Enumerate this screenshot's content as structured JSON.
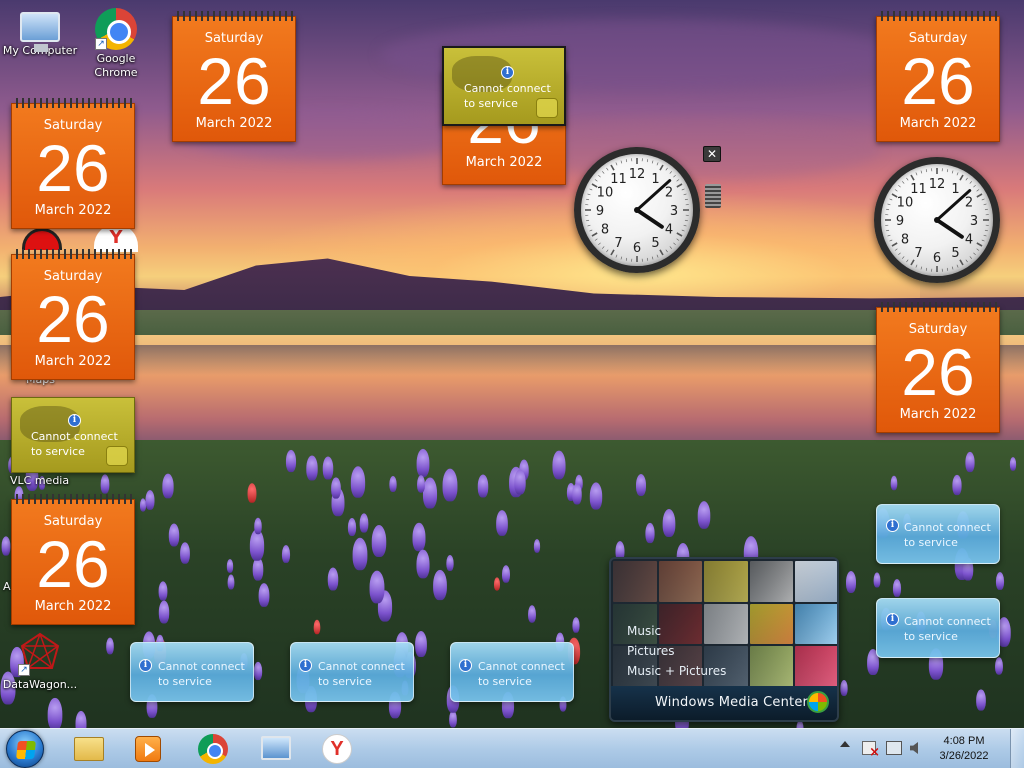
{
  "desktop": {
    "icons": [
      {
        "label": "My Computer",
        "icon": "computer-icon"
      },
      {
        "label": "Google Chrome",
        "icon": "chrome-icon"
      },
      {
        "label": "VLC media",
        "icon": "vlc-icon"
      },
      {
        "label": "DataWagon...",
        "icon": "datawagon-icon"
      }
    ],
    "partial_label_hidden": "A",
    "partial_label_maps": "Maps"
  },
  "calendars": [
    {
      "day_name": "Saturday",
      "day_num": "26",
      "month_year": "March 2022"
    },
    {
      "day_name": "Saturday",
      "day_num": "26",
      "month_year": "March 2022"
    },
    {
      "day_name": "Saturday",
      "day_num": "26",
      "month_year": "March 2022"
    },
    {
      "day_name": "Saturday",
      "day_num": "26",
      "month_year": "March 2022"
    },
    {
      "day_name": "Saturday",
      "day_num": "26",
      "month_year": "March 2022"
    },
    {
      "day_name": "Saturday",
      "day_num": "26",
      "month_year": "March 2022"
    },
    {
      "day_name": "Saturday",
      "day_num": "26",
      "month_year": "March 2022"
    }
  ],
  "weather": {
    "message_line1": "Cannot connect",
    "message_line2": "to service",
    "info_glyph": "i"
  },
  "clocks": [
    {
      "hour": 4,
      "minute": 8
    },
    {
      "hour": 4,
      "minute": 8
    }
  ],
  "clock_numbers": [
    "12",
    "1",
    "2",
    "3",
    "4",
    "5",
    "6",
    "7",
    "8",
    "9",
    "10",
    "11"
  ],
  "gadget_controls": {
    "close_glyph": "✕"
  },
  "media_center": {
    "menu": [
      "Music",
      "Pictures",
      "Music + Pictures"
    ],
    "title": "Windows Media Center"
  },
  "taskbar": {
    "pinned": [
      "windows-explorer-icon",
      "media-player-icon",
      "chrome-icon",
      "remote-desktop-icon",
      "yandex-icon"
    ],
    "yandex_glyph": "Y",
    "tray": {
      "time": "4:08 PM",
      "date": "3/26/2022"
    }
  },
  "colors": {
    "calendar_orange": "#e8620f",
    "weather_gold": "#bcb22e",
    "weather_blue": "#6fb8e6",
    "taskbar": "#b7cfe6"
  }
}
